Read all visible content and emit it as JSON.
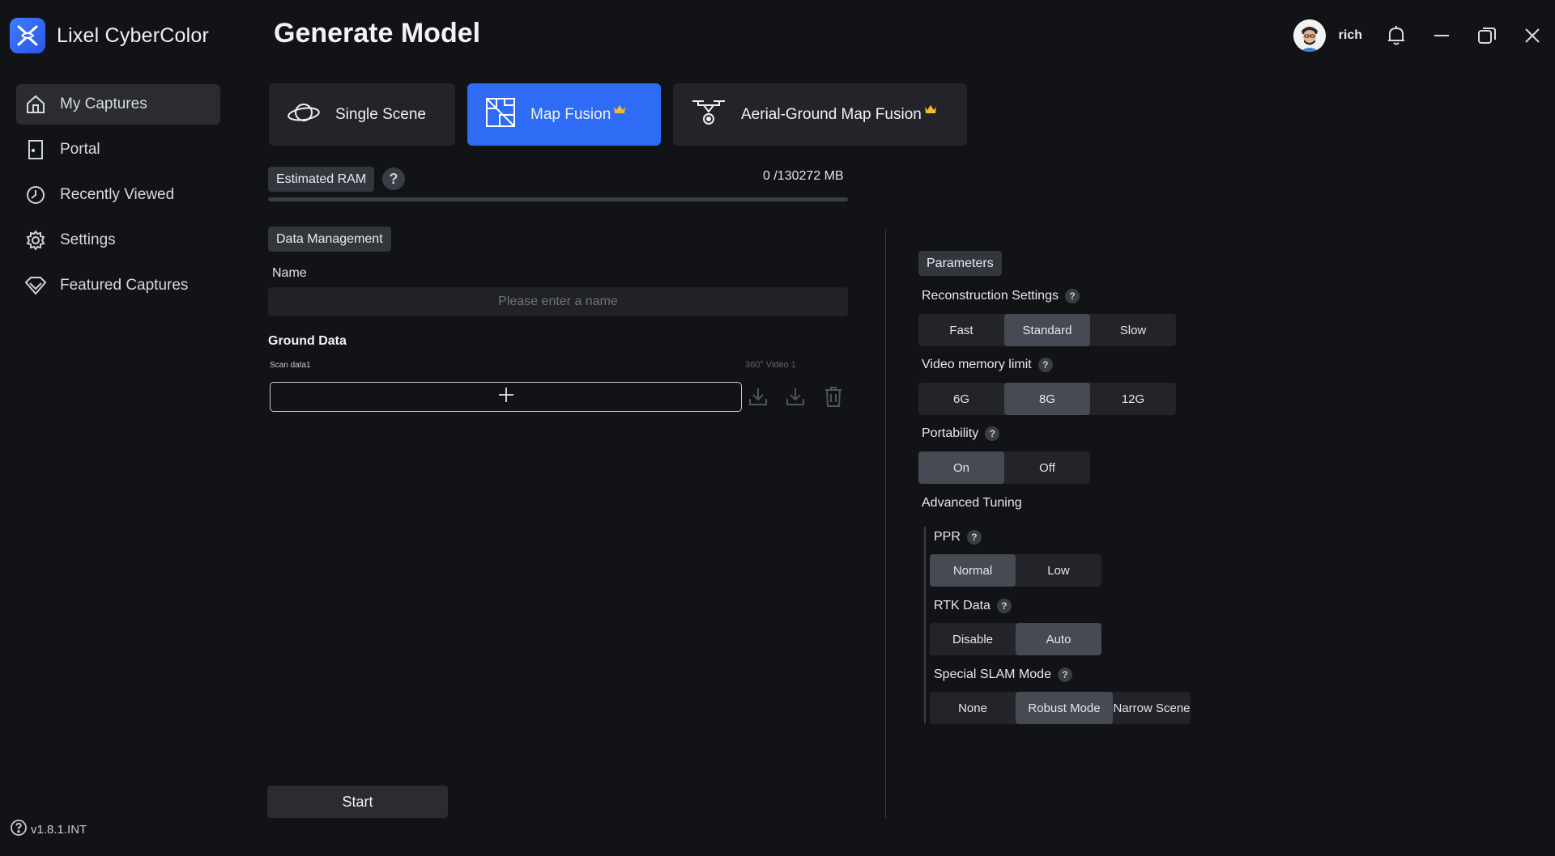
{
  "app": {
    "name": "Lixel CyberColor",
    "version": "v1.8.1.INT"
  },
  "header": {
    "title": "Generate Model",
    "username": "rich"
  },
  "sidebar": {
    "items": [
      {
        "label": "My Captures",
        "icon": "home-icon",
        "active": true
      },
      {
        "label": "Portal",
        "icon": "door-icon"
      },
      {
        "label": "Recently Viewed",
        "icon": "clock-icon"
      },
      {
        "label": "Settings",
        "icon": "gear-icon"
      },
      {
        "label": "Featured Captures",
        "icon": "diamond-icon"
      }
    ]
  },
  "modes": [
    {
      "label": "Single Scene",
      "icon": "planet-icon",
      "active": false,
      "premium": false
    },
    {
      "label": "Map Fusion",
      "icon": "map-fusion-icon",
      "active": true,
      "premium": true
    },
    {
      "label": "Aerial-Ground Map Fusion",
      "icon": "drone-icon",
      "active": false,
      "premium": true
    }
  ],
  "ram": {
    "label": "Estimated RAM",
    "value_text": "0 /130272 MB",
    "used": 0,
    "total": 130272
  },
  "data_management": {
    "label": "Data Management",
    "name_label": "Name",
    "name_placeholder": "Please enter a name",
    "name_value": "",
    "ground_data_title": "Ground Data",
    "scan_data_label": "Scan data1",
    "video_label": "360° Video 1"
  },
  "start_label": "Start",
  "parameters": {
    "label": "Parameters",
    "reconstruction": {
      "label": "Reconstruction Settings",
      "options": [
        "Fast",
        "Standard",
        "Slow"
      ],
      "selected": "Standard"
    },
    "video_memory": {
      "label": "Video memory limit",
      "options": [
        "6G",
        "8G",
        "12G"
      ],
      "selected": "8G"
    },
    "portability": {
      "label": "Portability",
      "options": [
        "On",
        "Off"
      ],
      "selected": "On"
    },
    "advanced_label": "Advanced Tuning",
    "ppr": {
      "label": "PPR",
      "options": [
        "Normal",
        "Low"
      ],
      "selected": "Normal"
    },
    "rtk": {
      "label": "RTK Data",
      "options": [
        "Disable",
        "Auto"
      ],
      "selected": "Auto"
    },
    "slam": {
      "label": "Special SLAM Mode",
      "options": [
        "None",
        "Robust Mode",
        "Narrow Scene"
      ],
      "selected": "Robust Mode"
    }
  },
  "colors": {
    "accent": "#2e6cf6",
    "crown": "#f5b82e",
    "background": "#121316"
  }
}
